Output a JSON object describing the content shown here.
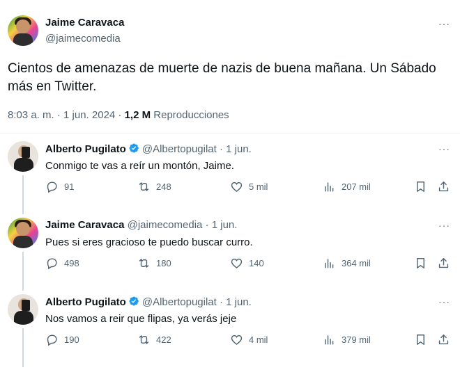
{
  "main_tweet": {
    "display_name": "Jaime Caravaca",
    "handle": "@jaimecomedia",
    "text": "Cientos de amenazas de muerte de nazis de buena mañana. Un Sábado más en Twitter.",
    "time": "8:03 a. m. · 1 jun. 2024 · ",
    "views_count": "1,2 M",
    "views_label": " Reproducciones",
    "more": "···"
  },
  "replies": [
    {
      "display_name": "Alberto Pugilato",
      "verified": true,
      "handle": "@Albertopugilat",
      "dot": " · ",
      "date": "1 jun.",
      "text": "Conmigo te vas a reír un montón, Jaime.",
      "replies": "91",
      "retweets": "248",
      "likes": "5 mil",
      "views": "207 mil",
      "more": "···"
    },
    {
      "display_name": "Jaime Caravaca",
      "verified": false,
      "handle": "@jaimecomedia",
      "dot": " · ",
      "date": "1 jun.",
      "text": "Pues si eres gracioso te puedo buscar curro.",
      "replies": "498",
      "retweets": "180",
      "likes": "140",
      "views": "364 mil",
      "more": "···"
    },
    {
      "display_name": "Alberto Pugilato",
      "verified": true,
      "handle": "@Albertopugilat",
      "dot": " · ",
      "date": "1 jun.",
      "text": "Nos vamos a reir que flipas, ya verás jeje",
      "replies": "190",
      "retweets": "422",
      "likes": "4 mil",
      "views": "379 mil",
      "more": "···"
    }
  ],
  "icons": {
    "reply": "reply-icon",
    "retweet": "retweet-icon",
    "like": "heart-icon",
    "views": "views-icon",
    "bookmark": "bookmark-icon",
    "share": "share-icon",
    "verified": "verified-badge-icon"
  },
  "colors": {
    "text": "#0f1419",
    "muted": "#536471",
    "verified": "#1d9bf0",
    "divider": "#eff3f4"
  }
}
